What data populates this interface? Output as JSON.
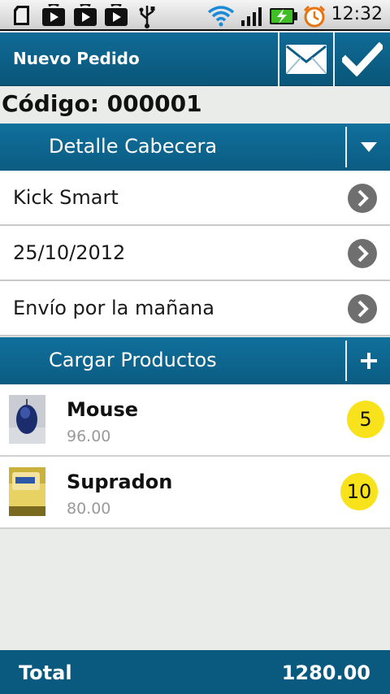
{
  "status_bar": {
    "time": "12:32",
    "icons": [
      "sd-card-icon",
      "play-store-icon",
      "play-store-icon",
      "play-store-icon",
      "usb-icon",
      "wifi-icon",
      "signal-icon",
      "battery-charging-icon",
      "alarm-icon"
    ]
  },
  "action_bar": {
    "title": "Nuevo Pedido",
    "actions": [
      "mail-icon",
      "check-icon"
    ]
  },
  "codigo": "Código: 000001",
  "header_section": {
    "label": "Detalle Cabecera",
    "action_icon": "triangle-down-icon"
  },
  "detail_rows": [
    {
      "text": "Kick Smart"
    },
    {
      "text": "25/10/2012"
    },
    {
      "text": "Envío por la mañana"
    }
  ],
  "products_section": {
    "label": "Cargar Productos",
    "action_icon": "plus-icon"
  },
  "products": [
    {
      "name": "Mouse",
      "price": "96.00",
      "quantity": "5"
    },
    {
      "name": "Supradon",
      "price": "80.00",
      "quantity": "10"
    }
  ],
  "footer": {
    "label": "Total",
    "value": "1280.00"
  },
  "colors": {
    "accent": "#0b5f86",
    "badge": "#f7e21b",
    "background": "#e9ece8"
  }
}
